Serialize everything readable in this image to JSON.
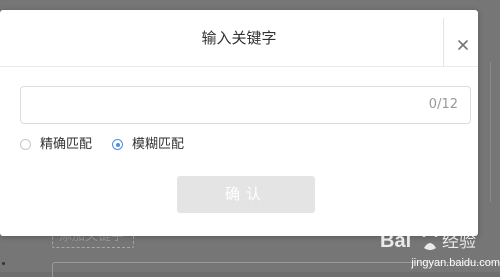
{
  "background_page": {
    "tag_label": "添加关键字"
  },
  "dialog": {
    "title": "输入关键字",
    "close_icon": "close-icon",
    "input": {
      "value": "",
      "placeholder": "",
      "counter": "0/12"
    },
    "match_options": [
      {
        "label": "精确匹配",
        "checked": false
      },
      {
        "label": "模糊匹配",
        "checked": true
      }
    ],
    "confirm_label": "确认",
    "confirm_enabled": false
  },
  "watermark": {
    "brand": "Baidu经验",
    "url": "jingyan.baidu.com"
  },
  "colors": {
    "overlay": "#767676",
    "accent": "#4a90e2",
    "disabled_button": "#e4e4e4"
  }
}
